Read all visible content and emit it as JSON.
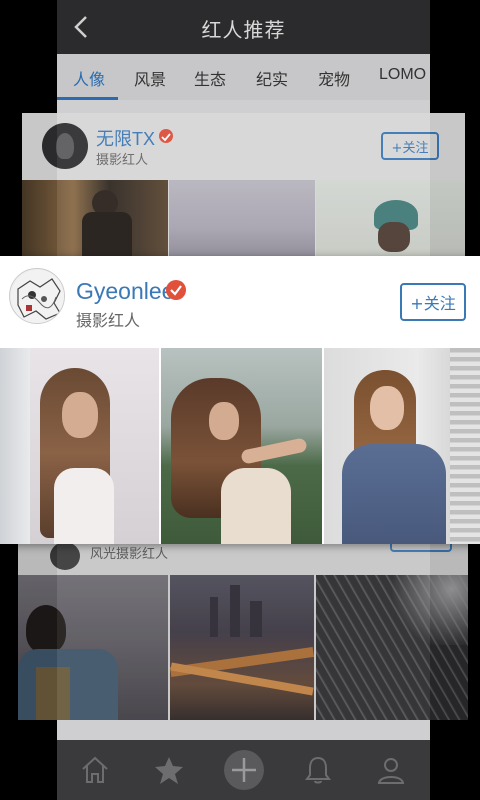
{
  "header": {
    "title": "红人推荐"
  },
  "tabs": [
    {
      "label": "人像",
      "active": true
    },
    {
      "label": "风景",
      "active": false
    },
    {
      "label": "生态",
      "active": false
    },
    {
      "label": "纪实",
      "active": false
    },
    {
      "label": "宠物",
      "active": false
    },
    {
      "label": "LOMO",
      "active": false
    }
  ],
  "cards": [
    {
      "name": "无限TX",
      "role": "摄影红人",
      "follow_label": "+关注"
    },
    {
      "name": "Gyeonlee",
      "role": "摄影红人",
      "follow_label": "+关注"
    },
    {
      "name": "",
      "role": "风光摄影红人",
      "follow_label": ""
    }
  ],
  "bottom_nav": [
    {
      "icon": "home-icon"
    },
    {
      "icon": "star-icon"
    },
    {
      "icon": "add-icon"
    },
    {
      "icon": "bell-icon"
    },
    {
      "icon": "profile-icon"
    }
  ],
  "colors": {
    "accent": "#3a78b6",
    "verified": "#e0503a",
    "title_bar": "#2b2b2d"
  }
}
